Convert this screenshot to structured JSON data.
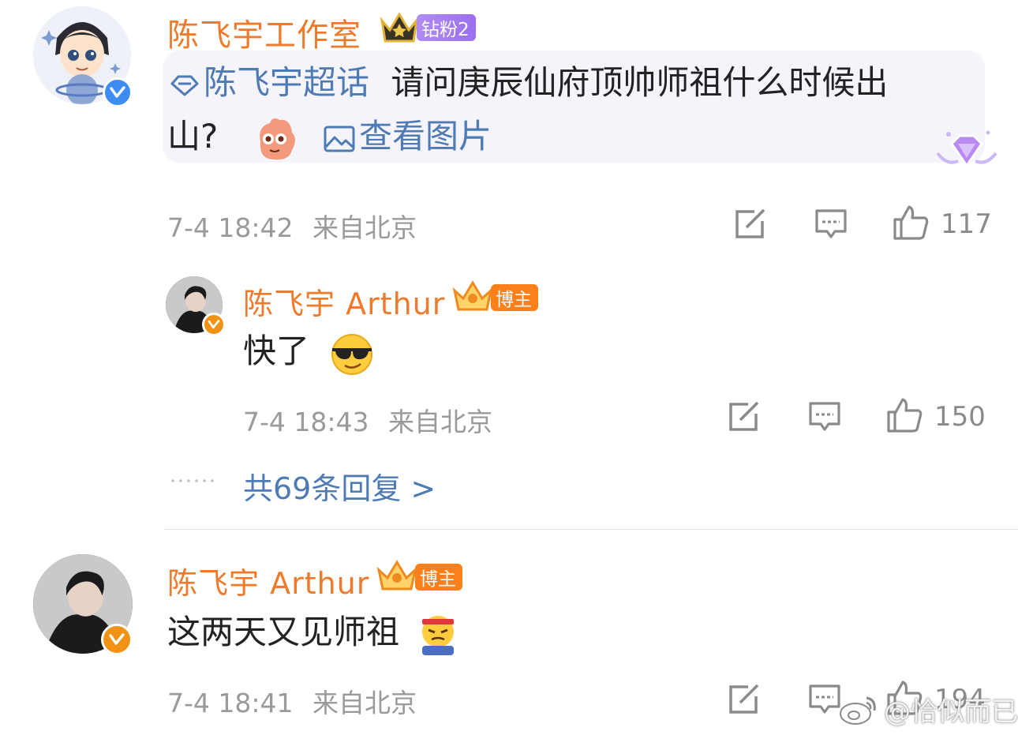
{
  "comment1": {
    "author": "陈飞宇工作室",
    "badge": "钻粉2",
    "topic": "陈飞宇超话",
    "text_line1": "请问庚辰仙府顶帅师祖什么时候出",
    "text_line2": "山?",
    "image_link": "查看图片",
    "time": "7-4 18:42",
    "location": "来自北京",
    "likes": "117"
  },
  "reply1": {
    "author": "陈飞宇 Arthur",
    "badge": "博主",
    "text": "快了",
    "emoji": "😎",
    "time": "7-4 18:43",
    "location": "来自北京",
    "likes": "150",
    "more_replies": "共69条回复 >"
  },
  "comment2": {
    "author": "陈飞宇 Arthur",
    "badge": "博主",
    "text": "这两天又见师祖",
    "emoji": "😤",
    "time": "7-4 18:41",
    "location": "来自北京",
    "likes": "194"
  },
  "watermark": "@恰似而已",
  "colors": {
    "name": "#ee7a2c",
    "link": "#4f7bb5",
    "meta": "#9a9a9a",
    "badge_orange": "#fb7f1b",
    "badge_purple": "#a77ff1"
  }
}
